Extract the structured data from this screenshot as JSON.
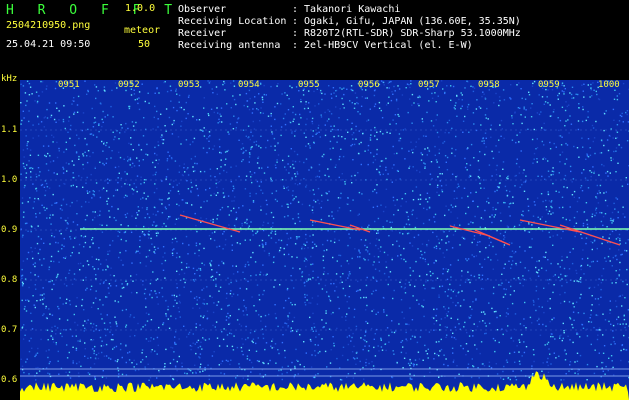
{
  "header": {
    "logo": "H R O F F T",
    "version": "1.0.0",
    "filename": "2504210950.png",
    "datetime": "25.04.21 09:50",
    "meteor_label": "meteor",
    "meteor_count": "50",
    "info": [
      {
        "key": "Observer",
        "value": ": Takanori Kawachi"
      },
      {
        "key": "Receiving Location",
        "value": ": Ogaki, Gifu, JAPAN (136.60E, 35.35N)"
      },
      {
        "key": "Receiver",
        "value": ": R820T2(RTL-SDR) SDR-Sharp 53.1000MHz"
      },
      {
        "key": "Receiving antenna",
        "value": ": 2el-HB9CV Vertical (el. E-W)"
      }
    ]
  },
  "axis": {
    "unit": "kHz",
    "freq_ticks": [
      "1.1",
      "1.0",
      "0.9",
      "0.8",
      "0.7",
      "0.6"
    ],
    "time_ticks": [
      "0951",
      "0952",
      "0953",
      "0954",
      "0955",
      "0956",
      "0957",
      "0958",
      "0959",
      "1000"
    ]
  },
  "colors": {
    "background": "#000000",
    "header_green": "#3bff3b",
    "header_yellow": "#ffff3b",
    "spectrum_base": "#0a2aa8",
    "spectrum_power": "#ffff00"
  }
}
